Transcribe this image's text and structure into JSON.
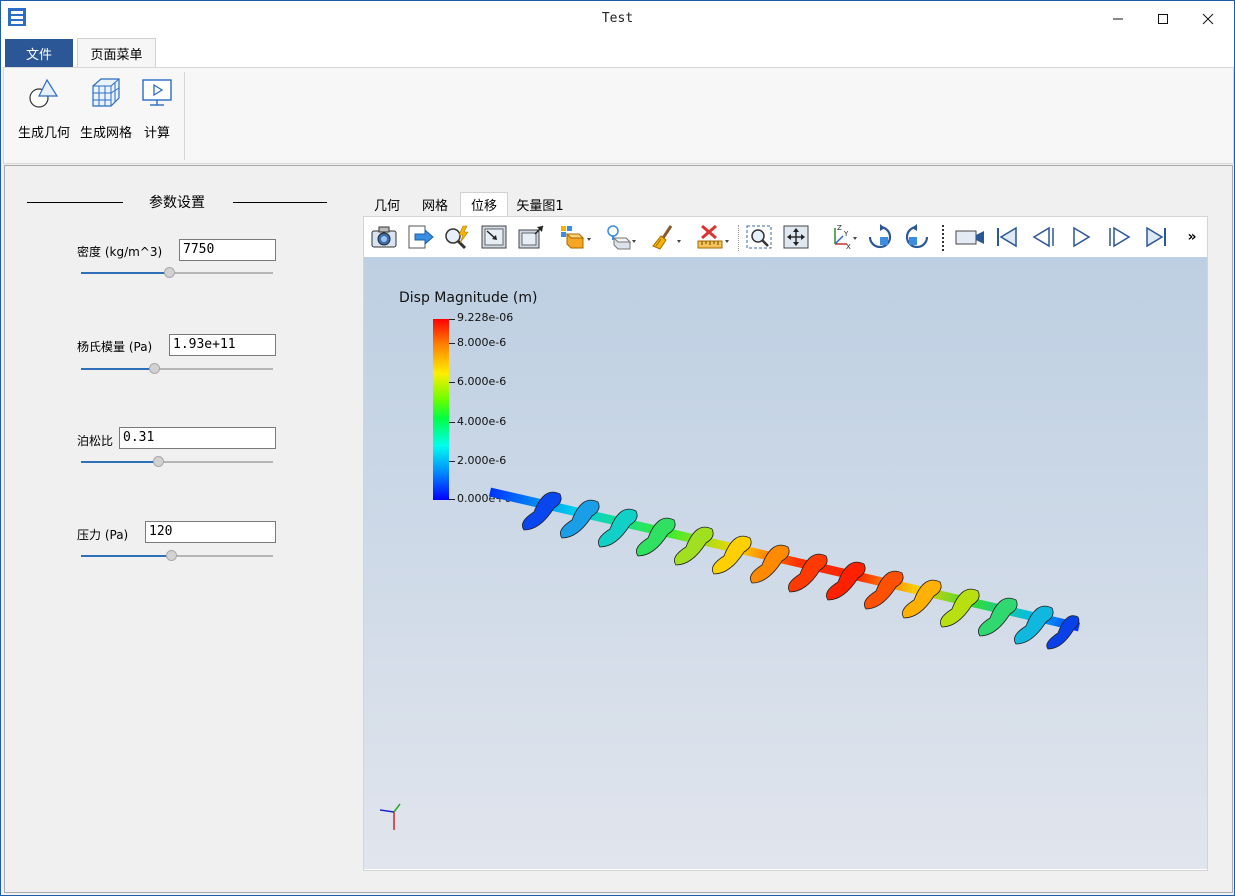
{
  "window": {
    "title": "Test",
    "minimize_icon": "minimize-icon",
    "maximize_icon": "maximize-icon",
    "close_icon": "close-icon"
  },
  "menu": {
    "file": "文件",
    "page_menu": "页面菜单"
  },
  "ribbon": {
    "geometry": "生成几何",
    "mesh": "生成网格",
    "compute": "计算"
  },
  "params": {
    "group_title": "参数设置",
    "density": {
      "label": "密度 (kg/m^3)",
      "value": "7750",
      "slider_fraction": 0.46
    },
    "youngs": {
      "label": "杨氏模量 (Pa)",
      "value": "1.93e+11",
      "slider_fraction": 0.38
    },
    "poisson": {
      "label": "泊松比",
      "value": "0.31",
      "slider_fraction": 0.4
    },
    "pressure": {
      "label": "压力 (Pa)",
      "value": "120",
      "slider_fraction": 0.47
    }
  },
  "tabs": [
    {
      "label": "几何",
      "active": false
    },
    {
      "label": "网格",
      "active": false
    },
    {
      "label": "位移",
      "active": true
    },
    {
      "label": "矢量图1",
      "active": false
    }
  ],
  "toolbar_icons": [
    "camera-icon",
    "export-icon",
    "pick-icon",
    "zoom-box-icon",
    "reset-view-icon",
    "render-mode-icon",
    "light-icon",
    "brush-icon",
    "ruler-icon",
    "zoom-window-icon",
    "fit-icon",
    "axes-icon",
    "rotate-cw-icon",
    "rotate-ccw-icon",
    "video-camera-icon",
    "first-frame-icon",
    "prev-frame-icon",
    "play-icon",
    "next-frame-icon",
    "last-frame-icon"
  ],
  "toolbar_more": "»",
  "legend": {
    "title": "Disp Magnitude (m)",
    "ticks": [
      "9.228e-06",
      "8.000e-6",
      "6.000e-6",
      "4.000e-6",
      "2.000e-6",
      "0.000e+00"
    ]
  }
}
